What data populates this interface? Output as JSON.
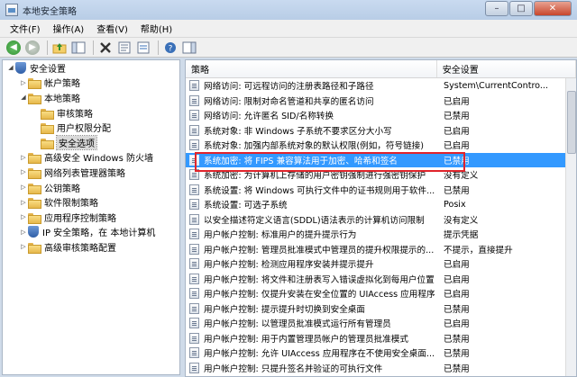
{
  "window": {
    "title": "本地安全策略",
    "controls": [
      "–",
      "□",
      "✕"
    ]
  },
  "menu": [
    "文件(F)",
    "操作(A)",
    "查看(V)",
    "帮助(H)"
  ],
  "tree": {
    "items": [
      {
        "label": "安全设置",
        "level": 0,
        "expanded": true,
        "icon": "shield-icon"
      },
      {
        "label": "帐户策略",
        "level": 1,
        "expanded": false,
        "icon": "folder-icon"
      },
      {
        "label": "本地策略",
        "level": 1,
        "expanded": true,
        "icon": "folder-icon"
      },
      {
        "label": "审核策略",
        "level": 2,
        "expanded": false,
        "icon": "folder-icon"
      },
      {
        "label": "用户权限分配",
        "level": 2,
        "expanded": false,
        "icon": "folder-icon"
      },
      {
        "label": "安全选项",
        "level": 2,
        "expanded": false,
        "icon": "folder-icon",
        "selected": true
      },
      {
        "label": "高级安全 Windows 防火墙",
        "level": 1,
        "expanded": false,
        "icon": "folder-icon"
      },
      {
        "label": "网络列表管理器策略",
        "level": 1,
        "expanded": false,
        "icon": "folder-icon"
      },
      {
        "label": "公钥策略",
        "level": 1,
        "expanded": false,
        "icon": "folder-icon"
      },
      {
        "label": "软件限制策略",
        "level": 1,
        "expanded": false,
        "icon": "folder-icon"
      },
      {
        "label": "应用程序控制策略",
        "level": 1,
        "expanded": false,
        "icon": "folder-icon"
      },
      {
        "label": "IP 安全策略，在 本地计算机",
        "level": 1,
        "expanded": false,
        "icon": "shield-icon"
      },
      {
        "label": "高级审核策略配置",
        "level": 1,
        "expanded": false,
        "icon": "folder-icon"
      }
    ]
  },
  "list": {
    "columns": [
      "策略",
      "安全设置"
    ],
    "rows": [
      {
        "policy": "网络访问: 可远程访问的注册表路径和子路径",
        "setting": "System\\CurrentContro..."
      },
      {
        "policy": "网络访问: 限制对命名管道和共享的匿名访问",
        "setting": "已启用"
      },
      {
        "policy": "网络访问: 允许匿名 SID/名称转换",
        "setting": "已禁用"
      },
      {
        "policy": "系统对象: 非 Windows 子系统不要求区分大小写",
        "setting": "已启用"
      },
      {
        "policy": "系统对象: 加强内部系统对象的默认权限(例如，符号链接)",
        "setting": "已启用"
      },
      {
        "policy": "系统加密: 将 FIPS 兼容算法用于加密、哈希和签名",
        "setting": "已禁用",
        "selected": true
      },
      {
        "policy": "系统加密: 为计算机上存储的用户密钥强制进行强密钥保护",
        "setting": "没有定义"
      },
      {
        "policy": "系统设置: 将 Windows 可执行文件中的证书规则用于软件...",
        "setting": "已禁用"
      },
      {
        "policy": "系统设置: 可选子系统",
        "setting": "Posix"
      },
      {
        "policy": "以安全描述符定义语言(SDDL)语法表示的计算机访问限制",
        "setting": "没有定义"
      },
      {
        "policy": "用户帐户控制: 标准用户的提升提示行为",
        "setting": "提示凭据"
      },
      {
        "policy": "用户帐户控制: 管理员批准模式中管理员的提升权限提示的...",
        "setting": "不提示，直接提升"
      },
      {
        "policy": "用户帐户控制: 检测应用程序安装并提示提升",
        "setting": "已启用"
      },
      {
        "policy": "用户帐户控制: 将文件和注册表写入错误虚拟化到每用户位置",
        "setting": "已启用"
      },
      {
        "policy": "用户帐户控制: 仅提升安装在安全位置的 UIAccess 应用程序",
        "setting": "已启用"
      },
      {
        "policy": "用户帐户控制: 提示提升时切换到安全桌面",
        "setting": "已禁用"
      },
      {
        "policy": "用户帐户控制: 以管理员批准模式运行所有管理员",
        "setting": "已启用"
      },
      {
        "policy": "用户帐户控制: 用于内置管理员帐户的管理员批准模式",
        "setting": "已禁用"
      },
      {
        "policy": "用户帐户控制: 允许 UIAccess 应用程序在不使用安全桌面...",
        "setting": "已禁用"
      },
      {
        "policy": "用户帐户控制: 只提升签名并验证的可执行文件",
        "setting": "已禁用"
      }
    ]
  },
  "colors": {
    "selection": "#3399ff",
    "highlight_border": "#e0242b"
  }
}
